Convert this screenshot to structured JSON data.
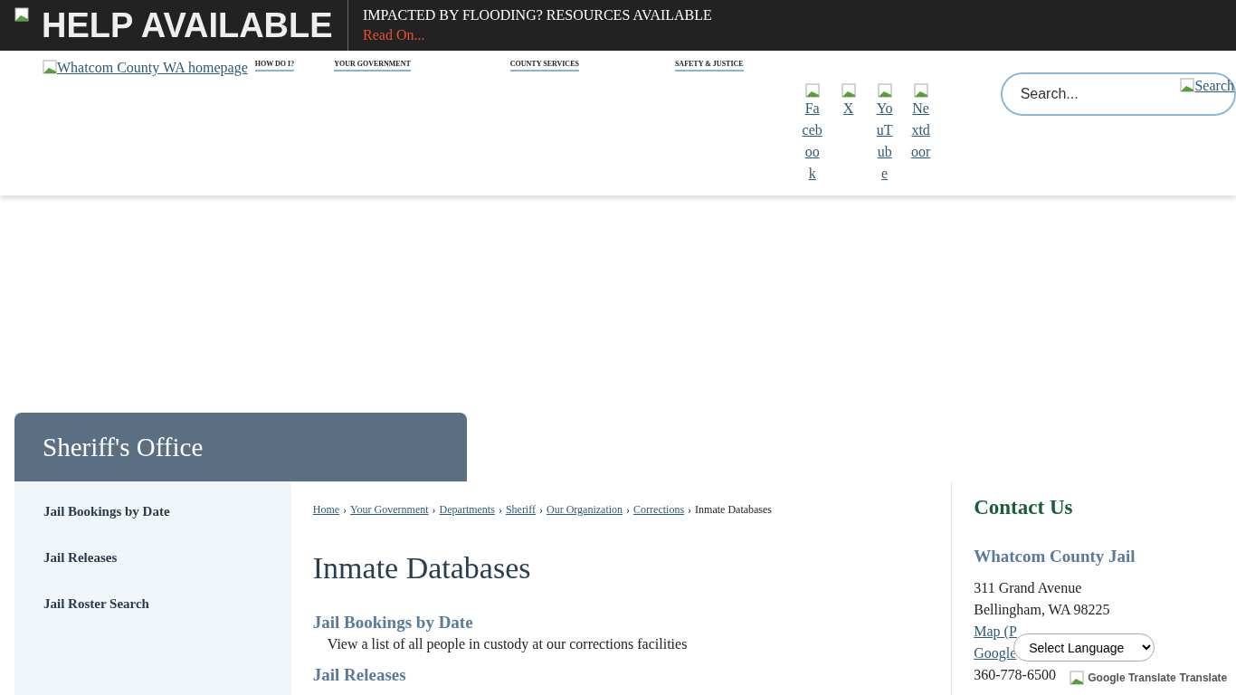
{
  "alert_bar": {
    "title": "HELP AVAILABLE",
    "headline": "IMPACTED BY FLOODING? RESOURCES AVAILABLE",
    "link": "Read On..."
  },
  "header": {
    "logo_alt": "Whatcom County WA homepage",
    "nav": [
      "HOW DO I?",
      "YOUR GOVERNMENT",
      "COUNTY SERVICES",
      "SAFETY & JUSTICE"
    ],
    "social": [
      "Facebook",
      "X",
      "YouTube",
      "Nextdoor"
    ],
    "search": {
      "placeholder": "Search...",
      "button_alt": "Search"
    }
  },
  "banner": {
    "title": "Sheriff's Office"
  },
  "sidebar": {
    "items": [
      "Jail Bookings by Date",
      "Jail Releases",
      "Jail Roster Search"
    ]
  },
  "breadcrumbs": {
    "links": [
      "Home",
      "Your Government",
      "Departments",
      "Sheriff",
      "Our Organization",
      "Corrections"
    ],
    "separator": "›",
    "current": "Inmate Databases"
  },
  "page_title": "Inmate Databases",
  "sections": [
    {
      "title": "Jail Bookings by Date",
      "description": "View a list of all people in custody at our corrections facilities"
    },
    {
      "title": "Jail Releases"
    }
  ],
  "contact": {
    "heading": "Contact Us",
    "name": "Whatcom County Jail",
    "address": [
      "311 Grand Avenue",
      "Bellingham, WA 98225"
    ],
    "links": [
      "Map (P",
      "Google"
    ],
    "phone": "360-778-6500"
  },
  "translate": {
    "select": "Select Language",
    "logo_alt": "Google Translate",
    "label": "Translate"
  }
}
